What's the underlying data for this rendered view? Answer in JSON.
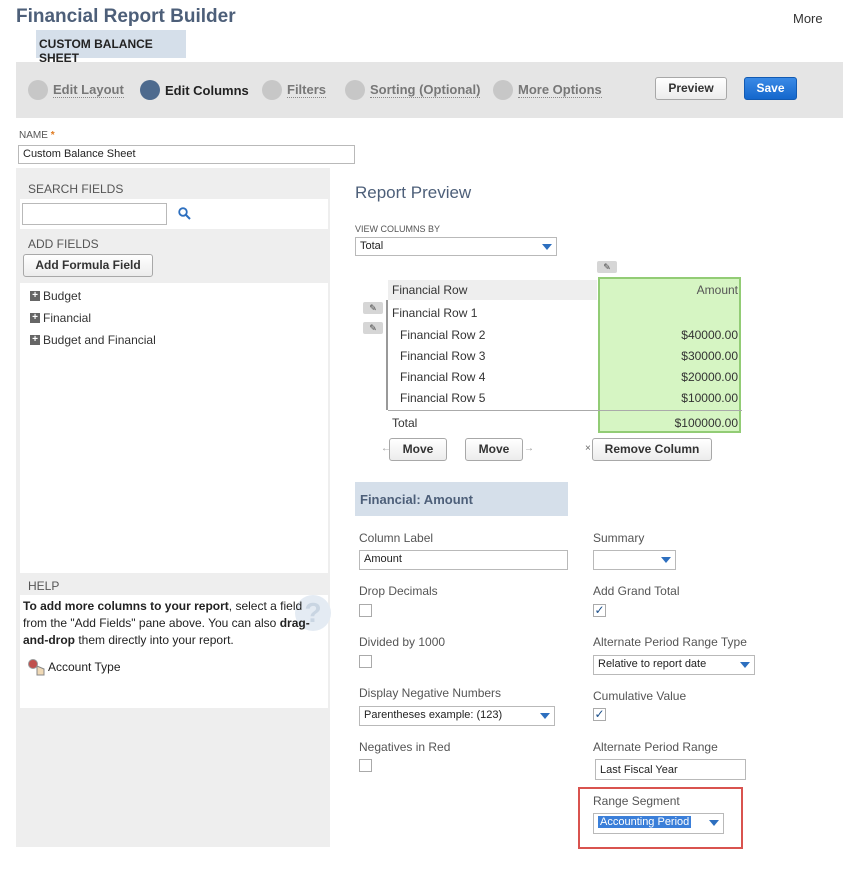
{
  "header": {
    "title": "Financial Report Builder",
    "more_label": "More",
    "record_tab": "CUSTOM BALANCE SHEET"
  },
  "steps": [
    {
      "label": "Edit Layout",
      "active": false
    },
    {
      "label": "Edit Columns",
      "active": true
    },
    {
      "label": "Filters",
      "active": false
    },
    {
      "label": "Sorting (Optional)",
      "active": false
    },
    {
      "label": "More Options",
      "active": false
    }
  ],
  "actions": {
    "preview_label": "Preview",
    "save_label": "Save"
  },
  "name_field": {
    "label": "NAME",
    "required_mark": "*",
    "value": "Custom Balance Sheet"
  },
  "left_panel": {
    "search_label": "SEARCH FIELDS",
    "search_value": "",
    "add_fields_label": "ADD FIELDS",
    "add_formula_label": "Add Formula Field",
    "tree": [
      "Budget",
      "Financial",
      "Budget and Financial"
    ],
    "help_label": "HELP",
    "help_bold_1": "To add more columns to your report",
    "help_text_1": ", select a field from the \"Add Fields\" pane above. You can also ",
    "help_bold_2": "drag-and-drop",
    "help_text_2": " them directly into your report.",
    "help_example": "Account Type"
  },
  "preview": {
    "title": "Report Preview",
    "view_columns_label": "VIEW COLUMNS BY",
    "view_columns_value": "Total",
    "col_header_row": "Financial Row",
    "col_header_amount": "Amount",
    "rows": [
      {
        "label": "Financial Row 1",
        "amount": ""
      },
      {
        "label": "Financial Row 2",
        "amount": "$40000.00"
      },
      {
        "label": "Financial Row 3",
        "amount": "$30000.00"
      },
      {
        "label": "Financial Row 4",
        "amount": "$20000.00"
      },
      {
        "label": "Financial Row 5",
        "amount": "$10000.00"
      }
    ],
    "total_label": "Total",
    "total_amount": "$100000.00",
    "move_left_label": "Move",
    "move_right_label": "Move",
    "remove_label": "Remove Column"
  },
  "column_settings": {
    "section_title": "Financial: Amount",
    "column_label_label": "Column Label",
    "column_label_value": "Amount",
    "drop_decimals_label": "Drop Decimals",
    "drop_decimals_checked": false,
    "divided_label": "Divided by 1000",
    "divided_checked": false,
    "display_negative_label": "Display Negative Numbers",
    "display_negative_value": "Parentheses  example: (123)",
    "negatives_red_label": "Negatives in Red",
    "negatives_red_checked": false,
    "summary_label": "Summary",
    "summary_value": "",
    "grand_total_label": "Add Grand Total",
    "grand_total_checked": true,
    "alt_range_type_label": "Alternate Period Range Type",
    "alt_range_type_value": "Relative to report date",
    "cumulative_label": "Cumulative Value",
    "cumulative_checked": true,
    "alt_range_label": "Alternate Period Range",
    "alt_range_value": "Last Fiscal Year",
    "range_segment_label": "Range Segment",
    "range_segment_value": "Accounting Period"
  },
  "colors": {
    "title": "#4d5f79",
    "active_step": "#4d6a8e",
    "save_button": "#1467cc",
    "amount_highlight": "#d6f5c3",
    "focus_outline": "#d9534f"
  }
}
